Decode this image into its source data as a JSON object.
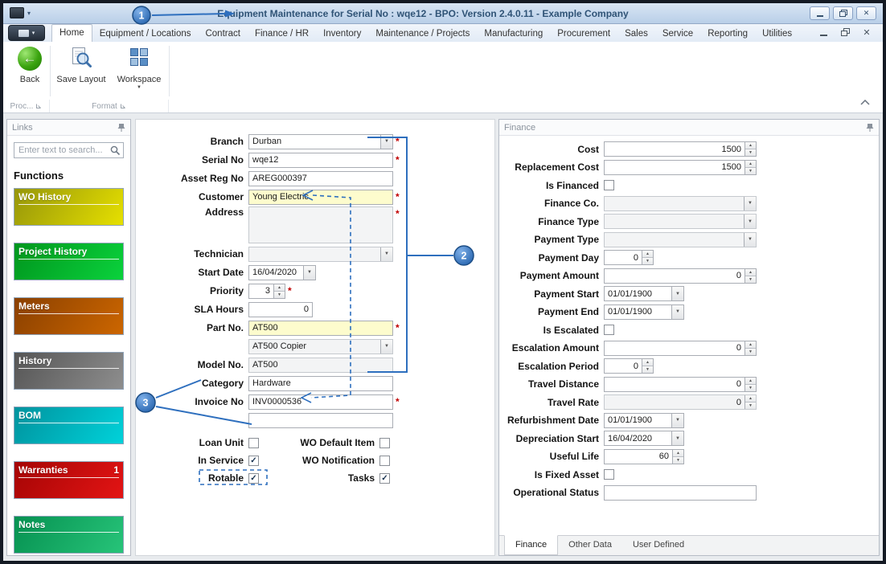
{
  "icons": {
    "close": "✕",
    "dropdown": "▼",
    "spin_up": "▲",
    "spin_down": "▼",
    "check": "✓",
    "back_arrow": "←",
    "app_caret": "▾"
  },
  "window": {
    "title": "Equipment Maintenance for Serial No : wqe12 - BPO: Version 2.4.0.11 - Example Company"
  },
  "ribbon": {
    "active_tab": "Home",
    "tabs": [
      "Home",
      "Equipment / Locations",
      "Contract",
      "Finance / HR",
      "Inventory",
      "Maintenance / Projects",
      "Manufacturing",
      "Procurement",
      "Sales",
      "Service",
      "Reporting",
      "Utilities"
    ],
    "buttons": [
      {
        "label": "Back"
      },
      {
        "label": "Save Layout"
      },
      {
        "label": "Workspace"
      }
    ],
    "groups": [
      {
        "label": "Proc..."
      },
      {
        "label": "Format"
      }
    ]
  },
  "links": {
    "title": "Links",
    "search_placeholder": "Enter text to search...",
    "heading": "Functions",
    "functions": [
      {
        "label": "WO History",
        "color_from": "#96960a",
        "color_to": "#e6e000"
      },
      {
        "label": "Project History",
        "color_from": "#00961e",
        "color_to": "#0ad23c"
      },
      {
        "label": "Meters",
        "color_from": "#8a4000",
        "color_to": "#cc6600"
      },
      {
        "label": "History",
        "color_from": "#555555",
        "color_to": "#8e8e8e"
      },
      {
        "label": "BOM",
        "color_from": "#00939e",
        "color_to": "#00d2da"
      },
      {
        "label": "Warranties",
        "badge": "1",
        "color_from": "#a50505",
        "color_to": "#e31414"
      },
      {
        "label": "Notes",
        "color_from": "#069151",
        "color_to": "#27c479"
      }
    ]
  },
  "form": {
    "required_marker": "*",
    "fields": [
      {
        "label": "Branch",
        "value": "Durban",
        "type": "dropdown",
        "required": true
      },
      {
        "label": "Serial No",
        "value": "wqe12",
        "type": "text",
        "required": true
      },
      {
        "label": "Asset Reg No",
        "value": "AREG000397",
        "type": "text"
      },
      {
        "label": "Customer",
        "value": "Young Electric",
        "type": "text",
        "required": true,
        "highlight": true
      },
      {
        "label": "Address",
        "value": "",
        "type": "textarea",
        "required": true,
        "disabled": true
      },
      {
        "label": "Technician",
        "value": "",
        "type": "dropdown",
        "disabled": true
      },
      {
        "label": "Start Date",
        "value": "16/04/2020",
        "type": "dropdown"
      },
      {
        "label": "Priority",
        "value": "3",
        "type": "spin",
        "required": true
      },
      {
        "label": "SLA Hours",
        "value": "0",
        "type": "text"
      },
      {
        "label": "Part No.",
        "value": "AT500",
        "type": "text",
        "required": true,
        "highlight": true
      },
      {
        "label": "",
        "value": "AT500 Copier",
        "type": "dropdown",
        "disabled": true
      },
      {
        "label": "Model No.",
        "value": "AT500",
        "type": "text",
        "disabled": true
      },
      {
        "label": "Category",
        "value": "Hardware",
        "type": "text"
      },
      {
        "label": "Invoice No",
        "value": "INV0000536",
        "type": "text",
        "required": true
      },
      {
        "label": "",
        "value": "",
        "type": "text"
      }
    ],
    "checkboxes": [
      [
        {
          "label": "Loan Unit",
          "checked": false
        },
        {
          "label": "WO Default Item",
          "checked": false
        }
      ],
      [
        {
          "label": "In Service",
          "checked": true
        },
        {
          "label": "WO Notification",
          "checked": false
        }
      ],
      [
        {
          "label": "Rotable",
          "checked": true
        },
        {
          "label": "Tasks",
          "checked": true
        }
      ]
    ]
  },
  "finance": {
    "title": "Finance",
    "fields": [
      {
        "label": "Cost",
        "value": "1500",
        "type": "spin"
      },
      {
        "label": "Replacement Cost",
        "value": "1500",
        "type": "spin"
      },
      {
        "label": "Is Financed",
        "type": "checkbox",
        "checked": false
      },
      {
        "label": "Finance Co.",
        "value": "",
        "type": "dropdown",
        "disabled": true
      },
      {
        "label": "Finance Type",
        "value": "",
        "type": "dropdown",
        "disabled": true
      },
      {
        "label": "Payment Type",
        "value": "",
        "type": "dropdown",
        "disabled": true
      },
      {
        "label": "Payment Day",
        "value": "0",
        "type": "spin"
      },
      {
        "label": "Payment Amount",
        "value": "0",
        "type": "spin"
      },
      {
        "label": "Payment Start",
        "value": "01/01/1900",
        "type": "dropdown"
      },
      {
        "label": "Payment End",
        "value": "01/01/1900",
        "type": "dropdown"
      },
      {
        "label": "Is Escalated",
        "type": "checkbox",
        "checked": false
      },
      {
        "label": "Escalation Amount",
        "value": "0",
        "type": "spin"
      },
      {
        "label": "Escalation Period",
        "value": "0",
        "type": "spin"
      },
      {
        "label": "Travel Distance",
        "value": "0",
        "type": "spin"
      },
      {
        "label": "Travel Rate",
        "value": "0",
        "type": "spin",
        "disabled": true
      },
      {
        "label": "Refurbishment Date",
        "value": "01/01/1900",
        "type": "dropdown"
      },
      {
        "label": "Depreciation Start",
        "value": "16/04/2020",
        "type": "dropdown"
      },
      {
        "label": "Useful Life",
        "value": "60",
        "type": "spin"
      },
      {
        "label": "Is Fixed Asset",
        "type": "checkbox",
        "checked": false
      },
      {
        "label": "Operational Status",
        "value": "",
        "type": "text"
      }
    ],
    "tabs": [
      {
        "label": "Finance",
        "active": true
      },
      {
        "label": "Other Data"
      },
      {
        "label": "User Defined"
      }
    ]
  },
  "annotations": {
    "accent": "#2e6fbe",
    "callouts": [
      {
        "n": "1"
      },
      {
        "n": "2"
      },
      {
        "n": "3"
      }
    ]
  }
}
